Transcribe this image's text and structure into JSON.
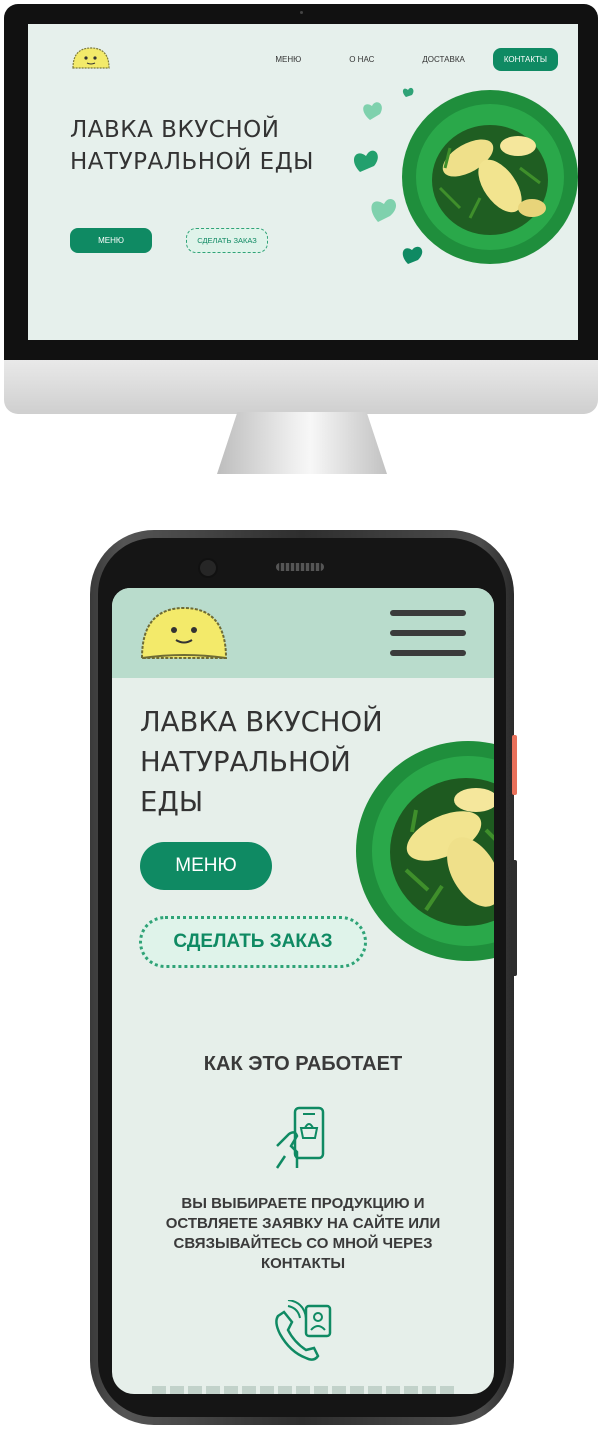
{
  "desktop": {
    "nav": {
      "menu": "МЕНЮ",
      "about": "О НАС",
      "delivery": "ДОСТАВКА",
      "contacts": "КОНТАКТЫ"
    },
    "hero_title": "ЛАВКА ВКУСНОЙ НАТУРАЛЬНОЙ ЕДЫ",
    "menu_button": "МЕНЮ",
    "order_button": "СДЕЛАТЬ ЗАКАЗ"
  },
  "mobile": {
    "hero_title": "ЛАВКА ВКУСНОЙ НАТУРАЛЬНОЙ ЕДЫ",
    "menu_button": "МЕНЮ",
    "order_button": "СДЕЛАТЬ ЗАКАЗ",
    "how_it_works_title": "КАК ЭТО РАБОТАЕТ",
    "step1_text": "ВЫ ВЫБИРАЕТЕ ПРОДУКЦИЮ И ОСТВЛЯЕТЕ ЗАЯВКУ НА САЙТЕ ИЛИ СВЯЗЫВАЙТЕСЬ СО МНОЙ ЧЕРЕЗ КОНТАКТЫ"
  },
  "colors": {
    "accent": "#0f8a63",
    "page_bg": "#e6efea",
    "header_bg": "#b9dccc",
    "logo_yellow": "#f3ea6a"
  },
  "icons": [
    "logo-dumpling-icon",
    "burger-menu-icon",
    "phone-shopping-icon",
    "phone-call-contact-icon",
    "heart-icon"
  ]
}
